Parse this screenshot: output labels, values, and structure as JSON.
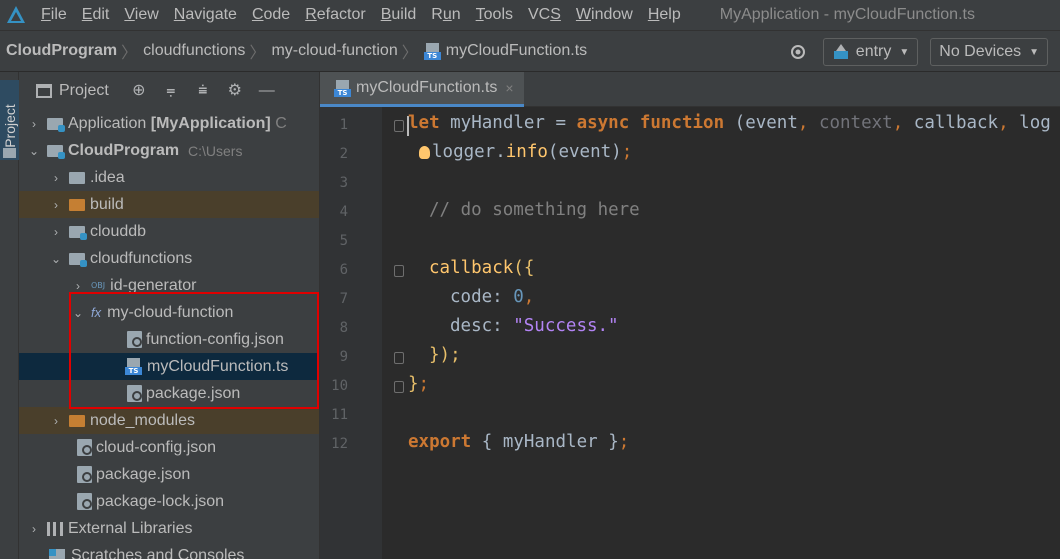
{
  "menubar": {
    "items": [
      {
        "pre": "",
        "u": "F",
        "post": "ile"
      },
      {
        "pre": "",
        "u": "E",
        "post": "dit"
      },
      {
        "pre": "",
        "u": "V",
        "post": "iew"
      },
      {
        "pre": "",
        "u": "N",
        "post": "avigate"
      },
      {
        "pre": "",
        "u": "C",
        "post": "ode"
      },
      {
        "pre": "",
        "u": "R",
        "post": "efactor"
      },
      {
        "pre": "",
        "u": "B",
        "post": "uild"
      },
      {
        "pre": "R",
        "u": "u",
        "post": "n"
      },
      {
        "pre": "",
        "u": "T",
        "post": "ools"
      },
      {
        "pre": "VC",
        "u": "S",
        "post": ""
      },
      {
        "pre": "",
        "u": "W",
        "post": "indow"
      },
      {
        "pre": "",
        "u": "H",
        "post": "elp"
      }
    ],
    "window_title": "MyApplication - myCloudFunction.ts"
  },
  "navbar": {
    "breadcrumbs": [
      "CloudProgram",
      "cloudfunctions",
      "my-cloud-function",
      "myCloudFunction.ts"
    ],
    "run_config": "entry",
    "device": "No Devices"
  },
  "toolstrip": {
    "label": "Project"
  },
  "project_panel": {
    "title": "Project",
    "header_buttons": [
      "⊕",
      "⩦",
      "⩧",
      "⚙",
      "—"
    ],
    "tree": [
      {
        "label": "Application",
        "suffix": "[MyApplication]",
        "extra": "C",
        "icon": "module",
        "arrow": "›",
        "indent": 0
      },
      {
        "label": "CloudProgram",
        "extra": "C:\\Users",
        "icon": "module",
        "arrow": "⌄",
        "indent": 0,
        "bold": true
      },
      {
        "label": ".idea",
        "icon": "folder",
        "arrow": "›",
        "indent": 1
      },
      {
        "label": "build",
        "icon": "folder-orange",
        "arrow": "›",
        "indent": 1,
        "excluded": true
      },
      {
        "label": "clouddb",
        "icon": "folder-blue",
        "arrow": "›",
        "indent": 1
      },
      {
        "label": "cloudfunctions",
        "icon": "folder-blue",
        "arrow": "⌄",
        "indent": 1
      },
      {
        "label": "id-generator",
        "icon": "obj",
        "arrow": "›",
        "indent": 2
      },
      {
        "label": "my-cloud-function",
        "icon": "fx",
        "arrow": "⌄",
        "indent": 2
      },
      {
        "label": "function-config.json",
        "icon": "json",
        "arrow": "",
        "indent": 3
      },
      {
        "label": "myCloudFunction.ts",
        "icon": "ts",
        "arrow": "",
        "indent": 3,
        "selected": true
      },
      {
        "label": "package.json",
        "icon": "json",
        "arrow": "",
        "indent": 3
      },
      {
        "label": "node_modules",
        "icon": "folder-orange",
        "arrow": "›",
        "indent": 1,
        "excluded": true
      },
      {
        "label": "cloud-config.json",
        "icon": "json",
        "arrow": "",
        "indent": 1
      },
      {
        "label": "package.json",
        "icon": "json",
        "arrow": "",
        "indent": 1
      },
      {
        "label": "package-lock.json",
        "icon": "json",
        "arrow": "",
        "indent": 1
      },
      {
        "label": "External Libraries",
        "icon": "libs",
        "arrow": "›",
        "indent": 0
      },
      {
        "label": "Scratches and Consoles",
        "icon": "scratch",
        "arrow": "",
        "indent": 0
      }
    ]
  },
  "editor": {
    "tab_label": "myCloudFunction.ts",
    "tab_close": "×",
    "line_numbers": [
      "1",
      "2",
      "3",
      "4",
      "5",
      "6",
      "7",
      "8",
      "9",
      "10",
      "11",
      "12"
    ],
    "code": {
      "l1": {
        "kw_let": "let",
        "name": " myHandler = ",
        "kw_async": "async",
        "sp": " ",
        "kw_function": "function",
        "open": " (",
        "p1": "event",
        "c1": ", ",
        "p2": "context",
        "c2": ", ",
        "p3": "callback",
        "c3": ", ",
        "p4": "log"
      },
      "l2": {
        "obj": "logger",
        "dot": ".",
        "method": "info",
        "args": "(event)",
        "semi": ";"
      },
      "l4": {
        "comment": "// do something here"
      },
      "l6": {
        "call": "callback",
        "open": "({"
      },
      "l7": {
        "key": "code",
        "colon": ": ",
        "value": "0",
        "comma": ","
      },
      "l8": {
        "key": "desc",
        "colon": ": ",
        "value": "\"Success.\""
      },
      "l9": {
        "close": "});"
      },
      "l10": {
        "close": "}",
        "semi": ";"
      },
      "l12": {
        "kw_export": "export",
        "open": " { ",
        "name": "myHandler",
        "close": " }",
        "semi": ";"
      }
    }
  }
}
